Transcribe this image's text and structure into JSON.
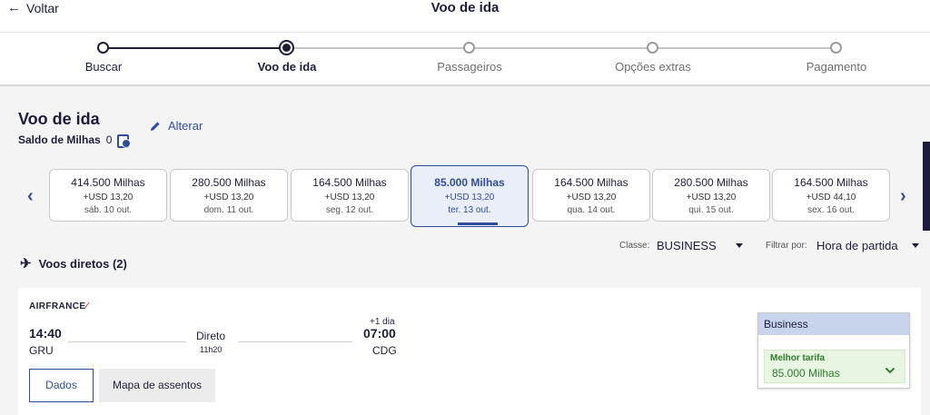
{
  "header": {
    "back_label": "Voltar",
    "title": "Voo de ida"
  },
  "steps": [
    {
      "label": "Buscar",
      "state": "done"
    },
    {
      "label": "Voo de ida",
      "state": "active"
    },
    {
      "label": "Passageiros",
      "state": "todo"
    },
    {
      "label": "Opções extras",
      "state": "todo"
    },
    {
      "label": "Pagamento",
      "state": "todo"
    }
  ],
  "main": {
    "title": "Voo de ida",
    "miles_label": "Saldo de Milhas",
    "miles_value": "0",
    "edit_label": "Alterar"
  },
  "dates": [
    {
      "miles": "414.500 Milhas",
      "usd": "+USD 13,20",
      "date": "sáb. 10 out.",
      "selected": false
    },
    {
      "miles": "280.500 Milhas",
      "usd": "+USD 13,20",
      "date": "dom. 11 out.",
      "selected": false
    },
    {
      "miles": "164.500 Milhas",
      "usd": "+USD 13,20",
      "date": "seg. 12 out.",
      "selected": false
    },
    {
      "miles": "85.000 Milhas",
      "usd": "+USD 13,20",
      "date": "ter. 13 out.",
      "selected": true
    },
    {
      "miles": "164.500 Milhas",
      "usd": "+USD 13,20",
      "date": "qua. 14 out.",
      "selected": false
    },
    {
      "miles": "280.500 Milhas",
      "usd": "+USD 13,20",
      "date": "qui. 15 out.",
      "selected": false
    },
    {
      "miles": "164.500 Milhas",
      "usd": "+USD 44,10",
      "date": "sex. 16 out.",
      "selected": false
    }
  ],
  "filters": {
    "class_label": "Classe:",
    "class_value": "BUSINESS",
    "filter_label": "Filtrar por:",
    "filter_value": "Hora de partida"
  },
  "direct_flights_label": "Voos diretos (2)",
  "flight": {
    "airline": "AIRFRANCE",
    "dep_time": "14:40",
    "dep_airport": "GRU",
    "stop_label": "Direto",
    "duration": "11h20",
    "day_offset": "+1 dia",
    "arr_time": "07:00",
    "arr_airport": "CDG",
    "details_button": "Dados",
    "seatmap_button": "Mapa de assentos"
  },
  "fare": {
    "cabin": "Business",
    "best_label": "Melhor tarifa",
    "miles": "85.000 Milhas"
  },
  "colors": {
    "brand": "#2e4e9c",
    "navy": "#1d1d3b",
    "green": "#2f7d2a"
  }
}
